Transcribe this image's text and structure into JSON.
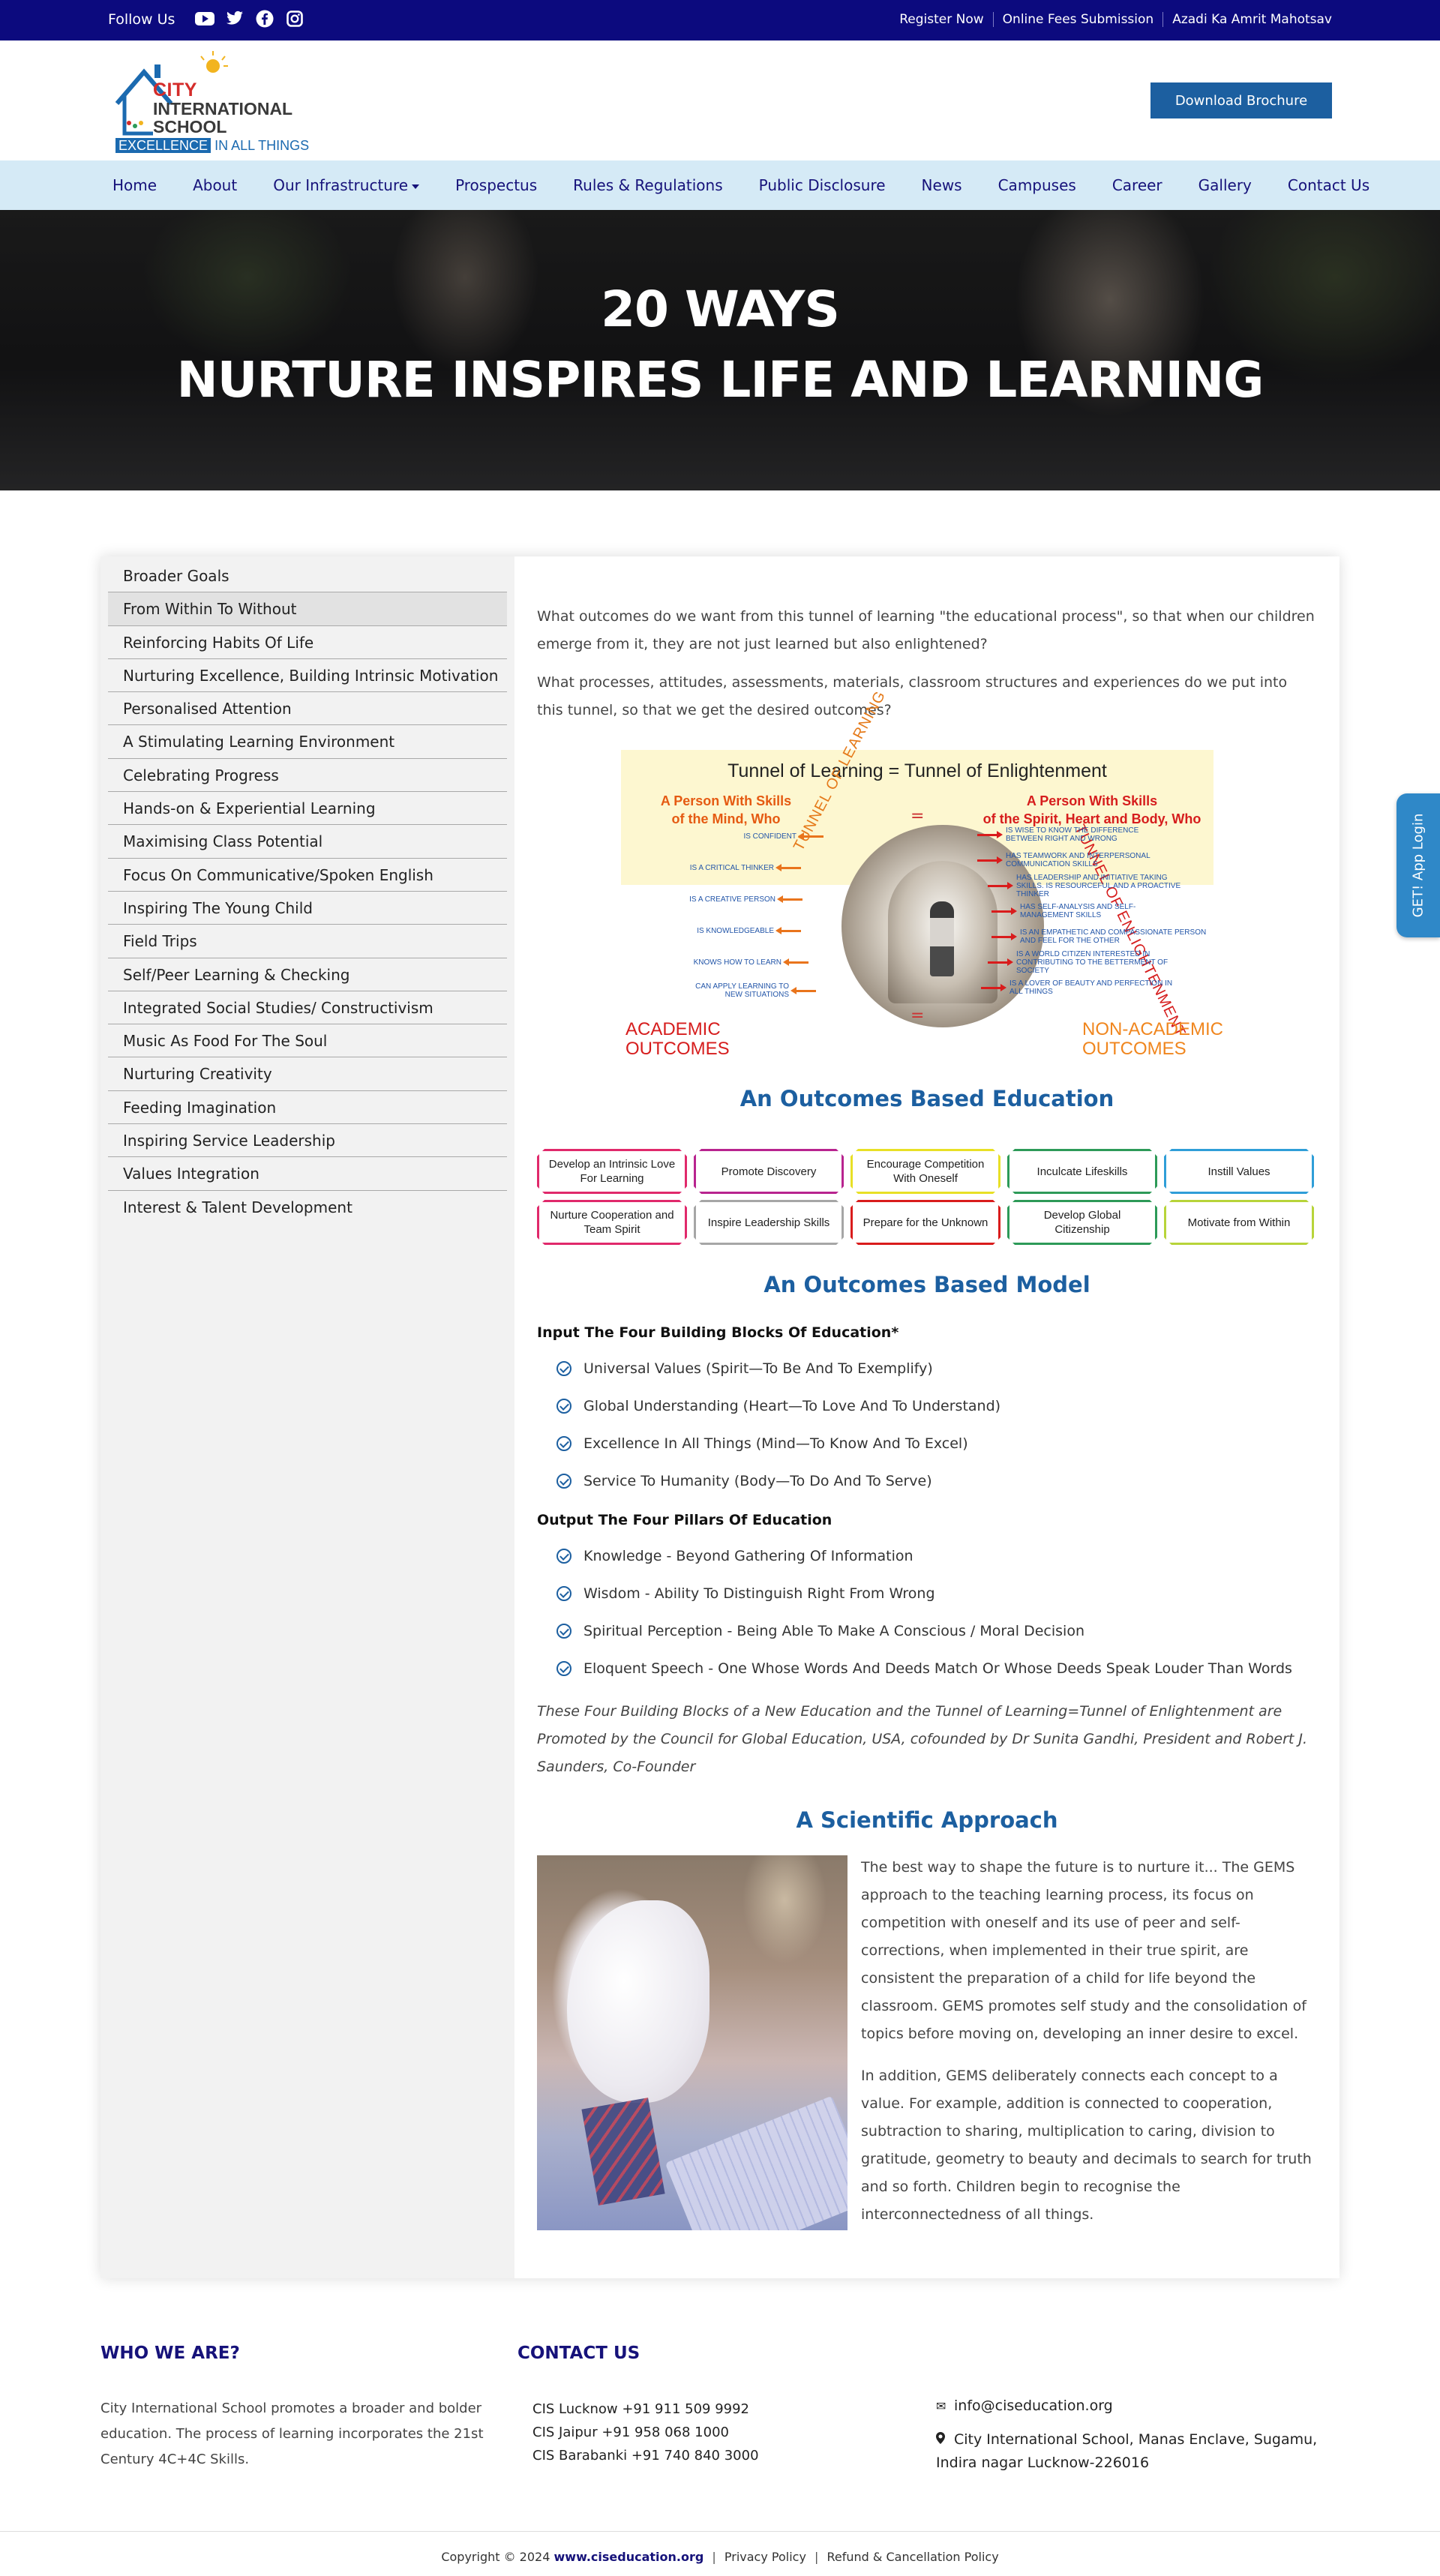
{
  "topbar": {
    "follow_label": "Follow Us",
    "social": [
      {
        "icon": "youtube-icon"
      },
      {
        "icon": "twitter-icon"
      },
      {
        "icon": "facebook-icon"
      },
      {
        "icon": "instagram-icon"
      }
    ],
    "links": [
      "Register Now",
      "Online Fees Submission",
      "Azadi Ka Amrit Mahotsav"
    ]
  },
  "header": {
    "logo": {
      "city": "CITY",
      "international": "INTERNATIONAL",
      "school": "SCHOOL",
      "tag_highlight": "EXCELLENCE",
      "tag_rest": "IN ALL THINGS"
    },
    "brochure_button": "Download Brochure"
  },
  "nav": {
    "items": [
      "Home",
      "About",
      "Our Infrastructure",
      "Prospectus",
      "Rules & Regulations",
      "Public Disclosure",
      "News",
      "Campuses",
      "Career",
      "Gallery",
      "Contact Us"
    ]
  },
  "hero": {
    "line1": "20 WAYS",
    "line2": "NURTURE INSPIRES LIFE AND LEARNING"
  },
  "sidebar": {
    "active_index": 1,
    "items": [
      "Broader Goals",
      "From Within To Without",
      "Reinforcing Habits Of Life",
      "Nurturing Excellence, Building Intrinsic Motivation",
      "Personalised Attention",
      "A Stimulating Learning Environment",
      "Celebrating Progress",
      "Hands-on & Experiential Learning",
      "Maximising Class Potential",
      "Focus On Communicative/Spoken English",
      "Inspiring The Young Child",
      "Field Trips",
      "Self/Peer Learning & Checking",
      "Integrated Social Studies/ Constructivism",
      "Music As Food For The Soul",
      "Nurturing Creativity",
      "Feeding Imagination",
      "Inspiring Service Leadership",
      "Values Integration",
      "Interest & Talent Development"
    ]
  },
  "content": {
    "intro1": "What outcomes do we want from this tunnel of learning \"the educational process\", so that when our children emerge from it, they are not just learned but also enlightened?",
    "intro2": "What processes, attitudes, assessments, materials, classroom structures and experiences do we put into this tunnel, so that we get the desired outcomes?",
    "tunnel": {
      "title": "Tunnel of Learning =  Tunnel of Enlightenment",
      "left_heading_1": "A Person With Skills",
      "left_heading_2": "of the Mind, Who",
      "right_heading_1": "A Person With Skills",
      "right_heading_2": "of the Spirit, Heart and Body, Who",
      "equals": "=",
      "arc_left": "TUNNEL OF LEARNING",
      "arc_right": "TUNNEL OF ENLIGHTENMENT",
      "left_items": [
        "IS CONFIDENT",
        "IS A CRITICAL THINKER",
        "IS A CREATIVE PERSON",
        "IS KNOWLEDGEABLE",
        "KNOWS HOW TO LEARN",
        "CAN APPLY LEARNING TO NEW SITUATIONS"
      ],
      "right_items": [
        "IS WISE TO KNOW THE DIFFERENCE BETWEEN RIGHT AND WRONG",
        "HAS TEAMWORK AND INTERPERSONAL COMMUNICATION SKILLS",
        "HAS LEADERSHIP AND INITIATIVE TAKING SKILLS. IS RESOURCEFUL AND A PROACTIVE THINKER",
        "HAS SELF-ANALYSIS AND SELF-MANAGEMENT SKILLS",
        "IS AN EMPATHETIC AND COMPASSIONATE PERSON AND FEEL FOR THE OTHER",
        "IS A WORLD CITIZEN INTERESTED IN CONTRIBUTING TO THE BETTERMENT OF SOCIETY",
        "IS A LOVER OF BEAUTY AND PERFECTION IN ALL THINGS"
      ],
      "outcome_left_1": "ACADEMIC",
      "outcome_left_2": "OUTCOMES",
      "outcome_right_1": "NON-ACADEMIC",
      "outcome_right_2": "OUTCOMES"
    },
    "education_heading": "An Outcomes Based Education",
    "outcome_boxes": [
      {
        "label": "Develop an Intrinsic Love For Learning",
        "color": "#e0296b"
      },
      {
        "label": "Promote Discovery",
        "color": "#b8248f"
      },
      {
        "label": "Encourage Competition With Oneself",
        "color": "#e8e026"
      },
      {
        "label": "Inculcate Lifeskills",
        "color": "#2d9a58"
      },
      {
        "label": "Instill Values",
        "color": "#2f9ed8"
      },
      {
        "label": "Nurture Cooperation and Team Spirit",
        "color": "#e0296b"
      },
      {
        "label": "Inspire Leadership Skills",
        "color": "#a6a6a6"
      },
      {
        "label": "Prepare for the Unknown",
        "color": "#d91c1c"
      },
      {
        "label": "Develop Global Citizenship",
        "color": "#2d9a58"
      },
      {
        "label": "Motivate from Within",
        "color": "#b7d43a"
      }
    ],
    "model_heading": "An Outcomes Based Model",
    "input_heading": "Input The Four Building Blocks Of Education*",
    "input_items": [
      "Universal Values (Spirit—To Be And To Exemplify)",
      "Global Understanding (Heart—To Love And To Understand)",
      "Excellence In All Things (Mind—To Know And To Excel)",
      "Service To Humanity (Body—To Do And To Serve)"
    ],
    "output_heading": "Output The Four Pillars Of Education",
    "output_items": [
      "Knowledge - Beyond Gathering Of Information",
      "Wisdom - Ability To Distinguish Right From Wrong",
      "Spiritual Perception - Being Able To Make A Conscious / Moral Decision",
      "Eloquent Speech - One Whose Words And Deeds Match Or Whose Deeds Speak Louder Than Words"
    ],
    "note": "These Four Building Blocks of a New Education and the Tunnel of Learning=Tunnel of Enlightenment are Promoted by the Council for Global Education, USA, cofounded by Dr Sunita Gandhi, President and Robert J. Saunders, Co-Founder",
    "scientific_heading": "A Scientific Approach",
    "scientific_p1": "The best way to shape the future is to nurture it... The GEMS approach to the teaching learning process, its focus on competition with oneself and its use of peer and self-corrections, when implemented in their true spirit, are consistent the preparation of a child for life beyond the classroom. GEMS promotes self study and the consolidation of topics before moving on, developing an inner desire to excel.",
    "scientific_p2": "In addition, GEMS deliberately connects each concept to a value. For example, addition is connected to cooperation, subtraction to sharing, multiplication to caring, division to gratitude, geometry to beauty and decimals to search for truth and so forth. Children begin to recognise the interconnectedness of all things."
  },
  "app_tab": "GET! App Login",
  "footer": {
    "who_heading": "WHO WE ARE?",
    "who_text": "City International School promotes a broader and bolder education. The process of learning incorporates the 21st Century 4C+4C Skills.",
    "contact_heading": "CONTACT US",
    "phones": [
      "CIS Lucknow +91 911 509 9992",
      "CIS Jaipur +91 958 068 1000",
      "CIS Barabanki +91 740 840 3000"
    ],
    "email": "info@ciseducation.org",
    "address": "City International School, Manas Enclave, Sugamu, Indira nagar Lucknow-226016",
    "copyright": "Copyright © 2024",
    "site": "www.ciseducation.org",
    "privacy": "Privacy Policy",
    "refund": "Refund & Cancellation Policy"
  }
}
